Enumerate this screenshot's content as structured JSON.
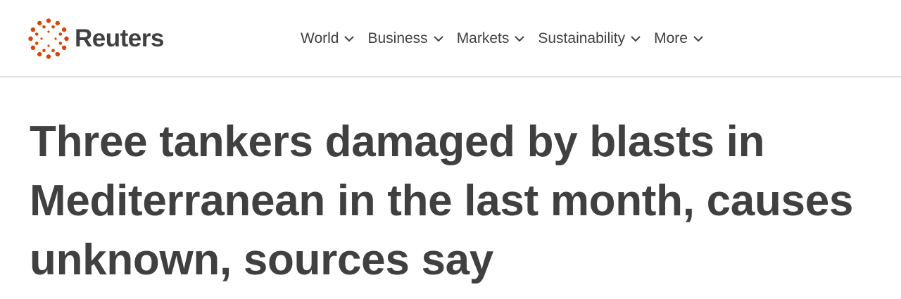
{
  "brand": {
    "name": "Reuters",
    "accent_color": "#dc4300",
    "text_color": "#404040"
  },
  "nav": {
    "items": [
      {
        "label": "World",
        "icon": "chevron-down-icon"
      },
      {
        "label": "Business",
        "icon": "chevron-down-icon"
      },
      {
        "label": "Markets",
        "icon": "chevron-down-icon"
      },
      {
        "label": "Sustainability",
        "icon": "chevron-down-icon"
      },
      {
        "label": "More",
        "icon": "chevron-down-icon"
      }
    ]
  },
  "article": {
    "headline": "Three tankers damaged by blasts in Mediterranean in the last month, causes unknown, sources say"
  }
}
